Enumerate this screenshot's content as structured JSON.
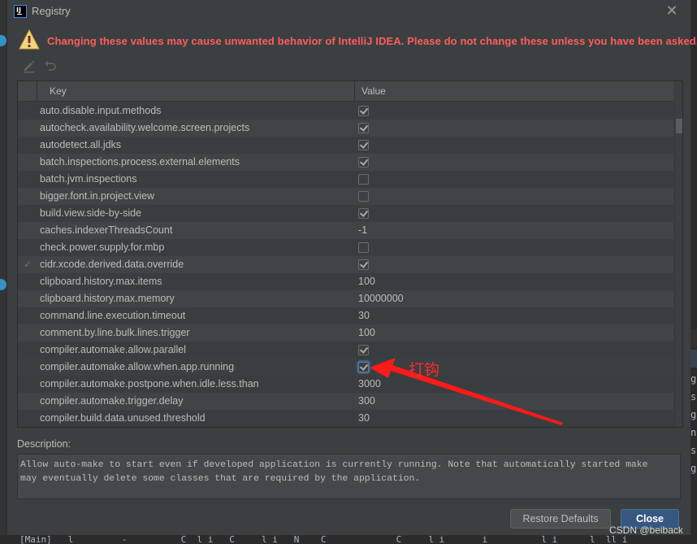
{
  "window": {
    "title": "Registry",
    "app_icon_text": "IJ",
    "close_icon": "close-icon"
  },
  "warning": {
    "icon": "warning-triangle-icon",
    "text": "Changing these values may cause unwanted behavior of IntelliJ IDEA. Please do not change these unless you have been asked.",
    "color": "#ff5c5c"
  },
  "toolbar": {
    "edit_icon": "pencil-icon",
    "revert_icon": "undo-icon"
  },
  "table": {
    "columns": [
      "Key",
      "Value"
    ],
    "rows": [
      {
        "key": "auto.disable.input.methods",
        "type": "bool",
        "value": true,
        "modified": false
      },
      {
        "key": "autocheck.availability.welcome.screen.projects",
        "type": "bool",
        "value": true,
        "modified": false
      },
      {
        "key": "autodetect.all.jdks",
        "type": "bool",
        "value": true,
        "modified": false
      },
      {
        "key": "batch.inspections.process.external.elements",
        "type": "bool",
        "value": true,
        "modified": false
      },
      {
        "key": "batch.jvm.inspections",
        "type": "bool",
        "value": false,
        "modified": false
      },
      {
        "key": "bigger.font.in.project.view",
        "type": "bool",
        "value": false,
        "modified": false
      },
      {
        "key": "build.view.side-by-side",
        "type": "bool",
        "value": true,
        "modified": false
      },
      {
        "key": "caches.indexerThreadsCount",
        "type": "text",
        "value": "-1",
        "modified": false
      },
      {
        "key": "check.power.supply.for.mbp",
        "type": "bool",
        "value": false,
        "modified": false
      },
      {
        "key": "cidr.xcode.derived.data.override",
        "type": "bool",
        "value": true,
        "modified": true
      },
      {
        "key": "clipboard.history.max.items",
        "type": "text",
        "value": "100",
        "modified": false
      },
      {
        "key": "clipboard.history.max.memory",
        "type": "text",
        "value": "10000000",
        "modified": false
      },
      {
        "key": "command.line.execution.timeout",
        "type": "text",
        "value": "30",
        "modified": false
      },
      {
        "key": "comment.by.line.bulk.lines.trigger",
        "type": "text",
        "value": "100",
        "modified": false
      },
      {
        "key": "compiler.automake.allow.parallel",
        "type": "bool",
        "value": true,
        "modified": false
      },
      {
        "key": "compiler.automake.allow.when.app.running",
        "type": "bool",
        "value": true,
        "modified": false,
        "focused": true
      },
      {
        "key": "compiler.automake.postpone.when.idle.less.than",
        "type": "text",
        "value": "3000",
        "modified": false
      },
      {
        "key": "compiler.automake.trigger.delay",
        "type": "text",
        "value": "300",
        "modified": false
      },
      {
        "key": "compiler.build.data.unused.threshold",
        "type": "text",
        "value": "30",
        "modified": false
      }
    ],
    "modified_marker": "✓"
  },
  "description": {
    "label": "Description:",
    "text": "Allow auto-make to start even if developed application is currently running. Note that automatically started make\nmay eventually delete some classes that are required by the application."
  },
  "buttons": {
    "restore_defaults": "Restore Defaults",
    "close": "Close"
  },
  "annotation": {
    "text": "打钩",
    "color": "#ff2a2a"
  },
  "watermark": "CSDN @beiback",
  "background": {
    "right_letters": [
      "g",
      "s",
      "g",
      "n",
      "s",
      "g"
    ],
    "bottom_code": "[Main]   l         -          C  l i   C     l i   N    C             C     l i       i          l i      l  ll i"
  }
}
